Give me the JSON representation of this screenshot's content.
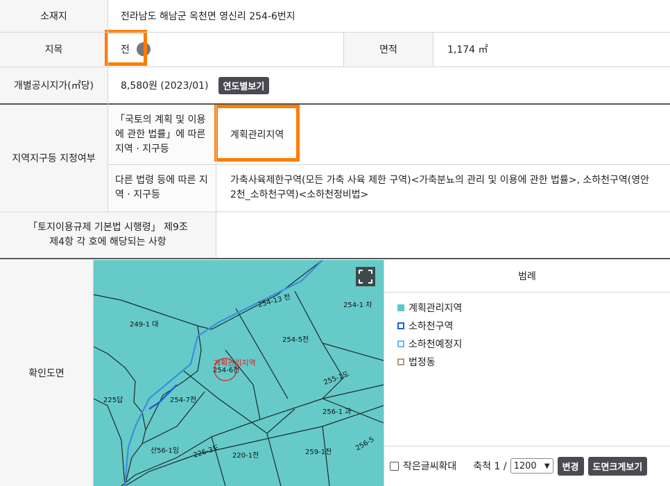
{
  "rows": {
    "location": {
      "label": "소재지",
      "value": "전라남도 해남군 옥천면 영신리 254-6번지"
    },
    "land_category": {
      "label": "지목",
      "value": "전"
    },
    "area": {
      "label": "면적",
      "value": "1,174 ㎡"
    },
    "price": {
      "label": "개별공시지가(㎡당)",
      "value": "8,580원 (2023/01)",
      "button": "연도별보기"
    },
    "zoning": {
      "label": "지역지구등 지정여부",
      "sub1_label": "「국토의 계획 및 이용에 관한 법률」에 따른 지역 · 지구등",
      "sub1_value": "계획관리지역",
      "sub2_label": "다른 법령 등에 따른 지역 · 지구등",
      "sub2_value": "가축사육제한구역(모든 가축 사육 제한 구역)<가축분뇨의 관리 및 이용에 관한 법률>, 소하천구역(영안2천_소하천구역)<소하천정비법>"
    },
    "regulation": {
      "label": "「토지이용규제 기본법 시행령」 제9조 제4항 각 호에 해당되는 사항",
      "value": ""
    },
    "map": {
      "label": "확인도면"
    }
  },
  "map_labels": {
    "a": "249-1 대",
    "b": "254-13 천",
    "c": "254-1 차",
    "d": "254-5전",
    "e": "계획관리지역",
    "f": "254-6전",
    "g": "255-1도",
    "h": "225답",
    "i": "254-7전",
    "j": "256-1 과",
    "k": "산56-1임",
    "l": "220-1전",
    "m": "259-1전",
    "n": "256-5",
    "o": "226-3도"
  },
  "legend": {
    "title": "범례",
    "items": [
      {
        "label": "계획관리지역",
        "color": "#5cc8c8",
        "fill": true
      },
      {
        "label": "소하천구역",
        "color": "#1f5fd6",
        "fill": false
      },
      {
        "label": "소하천예정지",
        "color": "#6ab8f0",
        "fill": false
      },
      {
        "label": "법정동",
        "color": "#b39a7a",
        "fill": false
      }
    ]
  },
  "controls": {
    "small_text_label": "작은글씨확대",
    "scale_label": "축척 1 /",
    "scale_value": "1200",
    "change_button": "변경",
    "enlarge_button": "도면크게보기"
  },
  "colors": {
    "map_bg": "#66cac8",
    "highlight": "#ff7d00",
    "button": "#4a4a52"
  }
}
